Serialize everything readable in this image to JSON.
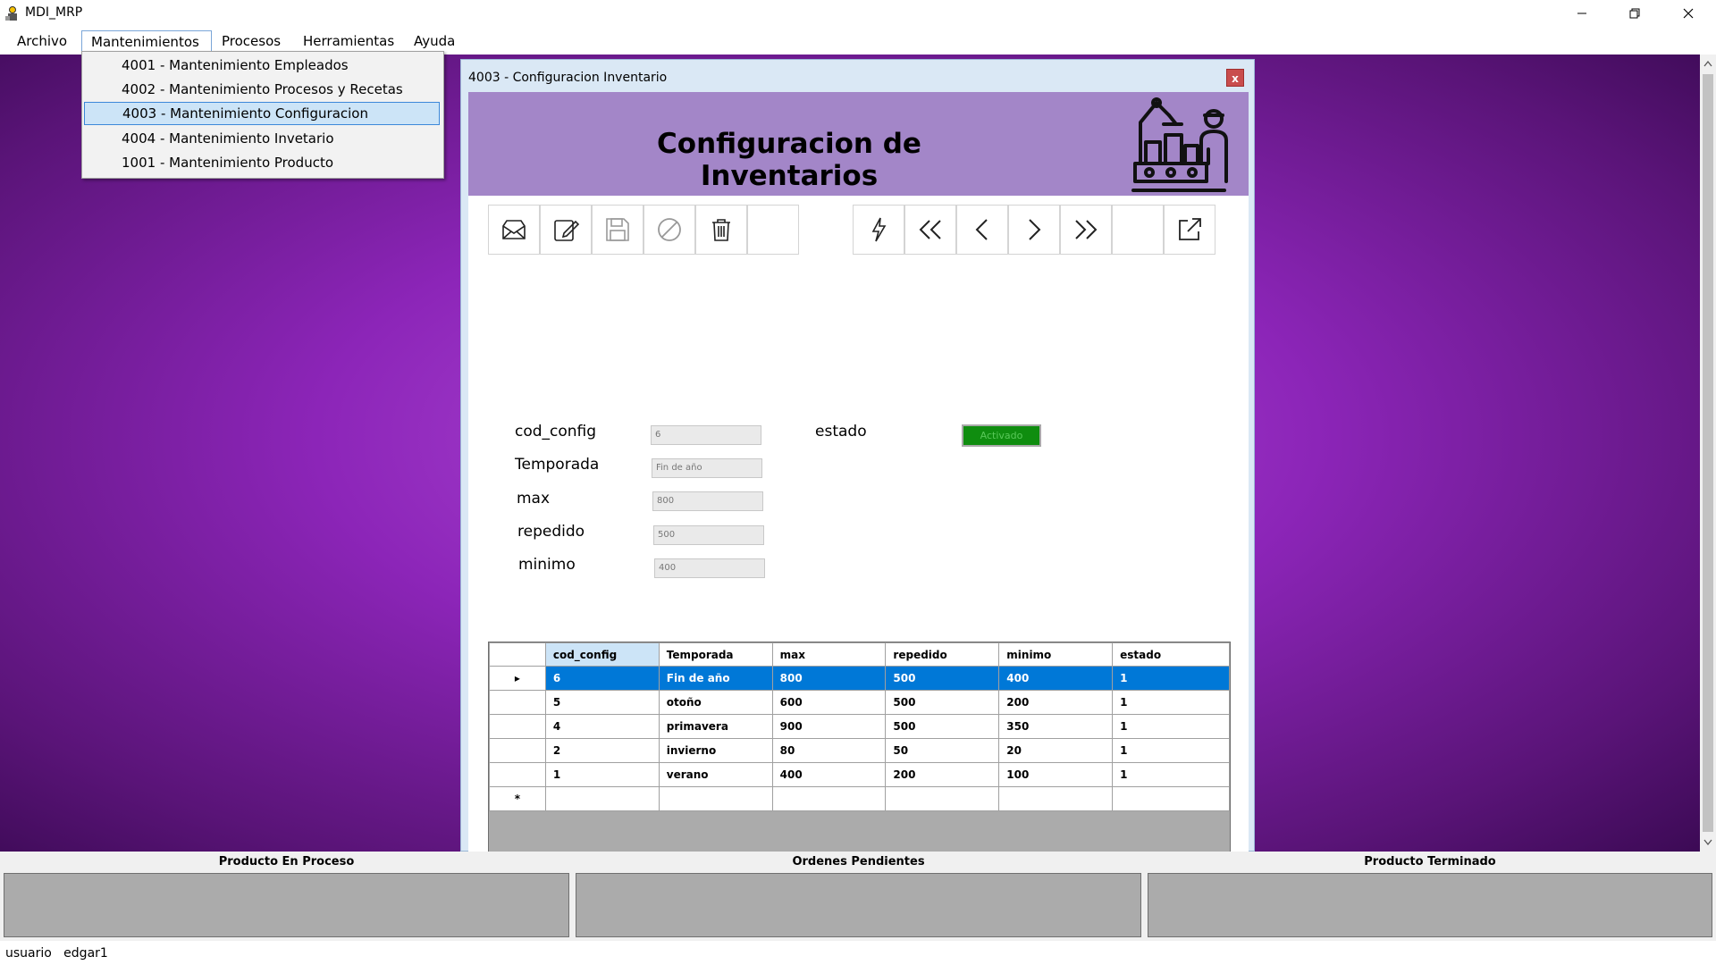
{
  "window": {
    "title": "MDI_MRP",
    "icon": "engineer-app-icon"
  },
  "menu": {
    "items": [
      "Archivo",
      "Mantenimientos",
      "Procesos",
      "Herramientas",
      "Ayuda"
    ],
    "open": "Mantenimientos",
    "dropdown": [
      "4001 - Mantenimiento Empleados",
      "4002 - Mantenimiento Procesos y Recetas",
      "4003 - Mantenimiento Configuracion",
      "4004 - Mantenimiento Invetario",
      "1001 - Mantenimiento Producto"
    ],
    "dropdown_selected": "4003 - Mantenimiento Configuracion"
  },
  "child": {
    "title": "4003 - Configuracion Inventario",
    "close_label": "x",
    "banner_title": "Configuracion de Inventarios",
    "banner_icon": "factory-worker-icon",
    "toolbar_left": [
      "inbox-icon",
      "edit-icon",
      "save-icon",
      "cancel-icon",
      "delete-icon",
      "blank"
    ],
    "toolbar_right": [
      "refresh-icon",
      "first-icon",
      "previous-icon",
      "next-icon",
      "last-icon",
      "blank",
      "export-icon"
    ],
    "form": {
      "cod_config": {
        "label": "cod_config",
        "value": "6"
      },
      "temporada": {
        "label": "Temporada",
        "value": "Fin de año"
      },
      "max": {
        "label": "max",
        "value": "800"
      },
      "repedido": {
        "label": "repedido",
        "value": "500"
      },
      "minimo": {
        "label": "minimo",
        "value": "400"
      },
      "estado": {
        "label": "estado",
        "button": "Activado",
        "color": "#0f8d0f"
      }
    },
    "grid": {
      "columns": [
        "cod_config",
        "Temporada",
        "max",
        "repedido",
        "minimo",
        "estado"
      ],
      "rows": [
        [
          "6",
          "Fin de año",
          "800",
          "500",
          "400",
          "1"
        ],
        [
          "5",
          "otoño",
          "600",
          "500",
          "200",
          "1"
        ],
        [
          "4",
          "primavera",
          "900",
          "500",
          "350",
          "1"
        ],
        [
          "2",
          "invierno",
          "80",
          "50",
          "20",
          "1"
        ],
        [
          "1",
          "verano",
          "400",
          "200",
          "100",
          "1"
        ]
      ],
      "selected_row": 0,
      "new_row_marker": "*",
      "current_marker": "▸"
    }
  },
  "panels": [
    "Producto En Proceso",
    "Ordenes Pendientes",
    "Producto Terminado"
  ],
  "status": {
    "text": "usuario   edgar1"
  },
  "colors": {
    "banner": "#a386c8",
    "selection": "#0078d7",
    "mdi_background": "#8c25b8"
  }
}
